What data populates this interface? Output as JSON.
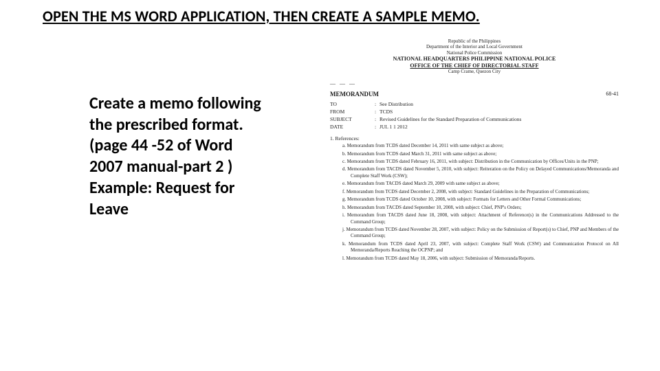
{
  "heading": "OPEN THE MS WORD APPLICATION, THEN CREATE A SAMPLE MEMO.",
  "instruction": "Create a memo following the prescribed format. (page 44 -52 of Word 2007 manual-part 2 ) Example: Request for Leave",
  "memo": {
    "header": {
      "line1": "Republic of the Philippines",
      "line2": "Department of the Interior and Local Government",
      "line3": "National Police Commission",
      "line4": "NATIONAL HEADQUARTERS PHILIPPINE NATIONAL POLICE",
      "line5": "OFFICE OF THE CHIEF OF DIRECTORIAL STAFF",
      "line6": "Camp Crame, Quezon City"
    },
    "dashes": "— — —",
    "title": "MEMORANDUM",
    "number": "68-41",
    "fields": {
      "to_label": "TO",
      "to_value": "See Distribution",
      "from_label": "FROM",
      "from_value": "TCDS",
      "subject_label": "SUBJECT",
      "subject_value": "Revised Guidelines for the Standard Preparation of Communications",
      "date_label": "DATE",
      "date_value": "JUL 1 1 2012"
    },
    "references_title": "1.  References:",
    "references": [
      "a.  Memorandum from TCDS dated December 14, 2011 with same subject as above;",
      "b.  Memorandum from TCDS dated March 31, 2011 with same subject as above;",
      "c.  Memorandum from TCDS dated February 16, 2011, with subject: Distribution in the Communication by Offices/Units in the PNP;",
      "d.  Memorandum from TACDS dated November 5, 2010, with subject: Reiteration on the Policy on Delayed Communications/Memoranda and Complete Staff Work (CSW);",
      "e.  Memorandum from TACDS dated March 29, 2009 with same subject as above;",
      "f.  Memorandum from TCDS dated December 2, 2008, with subject: Standard Guidelines in the Preparation of Communications;",
      "g.  Memorandum from TCDS dated October 10, 2008, with subject: Formats for Letters and Other Formal Communications;",
      "h.  Memorandum from TACDS dated September 10, 2008, with subject: Chief, PNP's Orders;",
      "i.  Memorandum from TACDS dated June 18, 2008, with subject: Attachment of Reference(s) in the Communications Addressed to the Command Group;",
      "j.  Memorandum from TCDS dated November 28, 2007, with subject: Policy on the Submission of Report(s) to Chief, PNP and Members of the Command Group;",
      "k.  Memorandum from TCDS dated April 23, 2007, with subject: Complete Staff Work (CSW) and Communication Protocol on All Memoranda/Reports Reaching the OCPNP; and",
      "l.  Memorandum from TCDS dated May 18, 2006, with subject: Submission of Memoranda/Reports."
    ]
  }
}
